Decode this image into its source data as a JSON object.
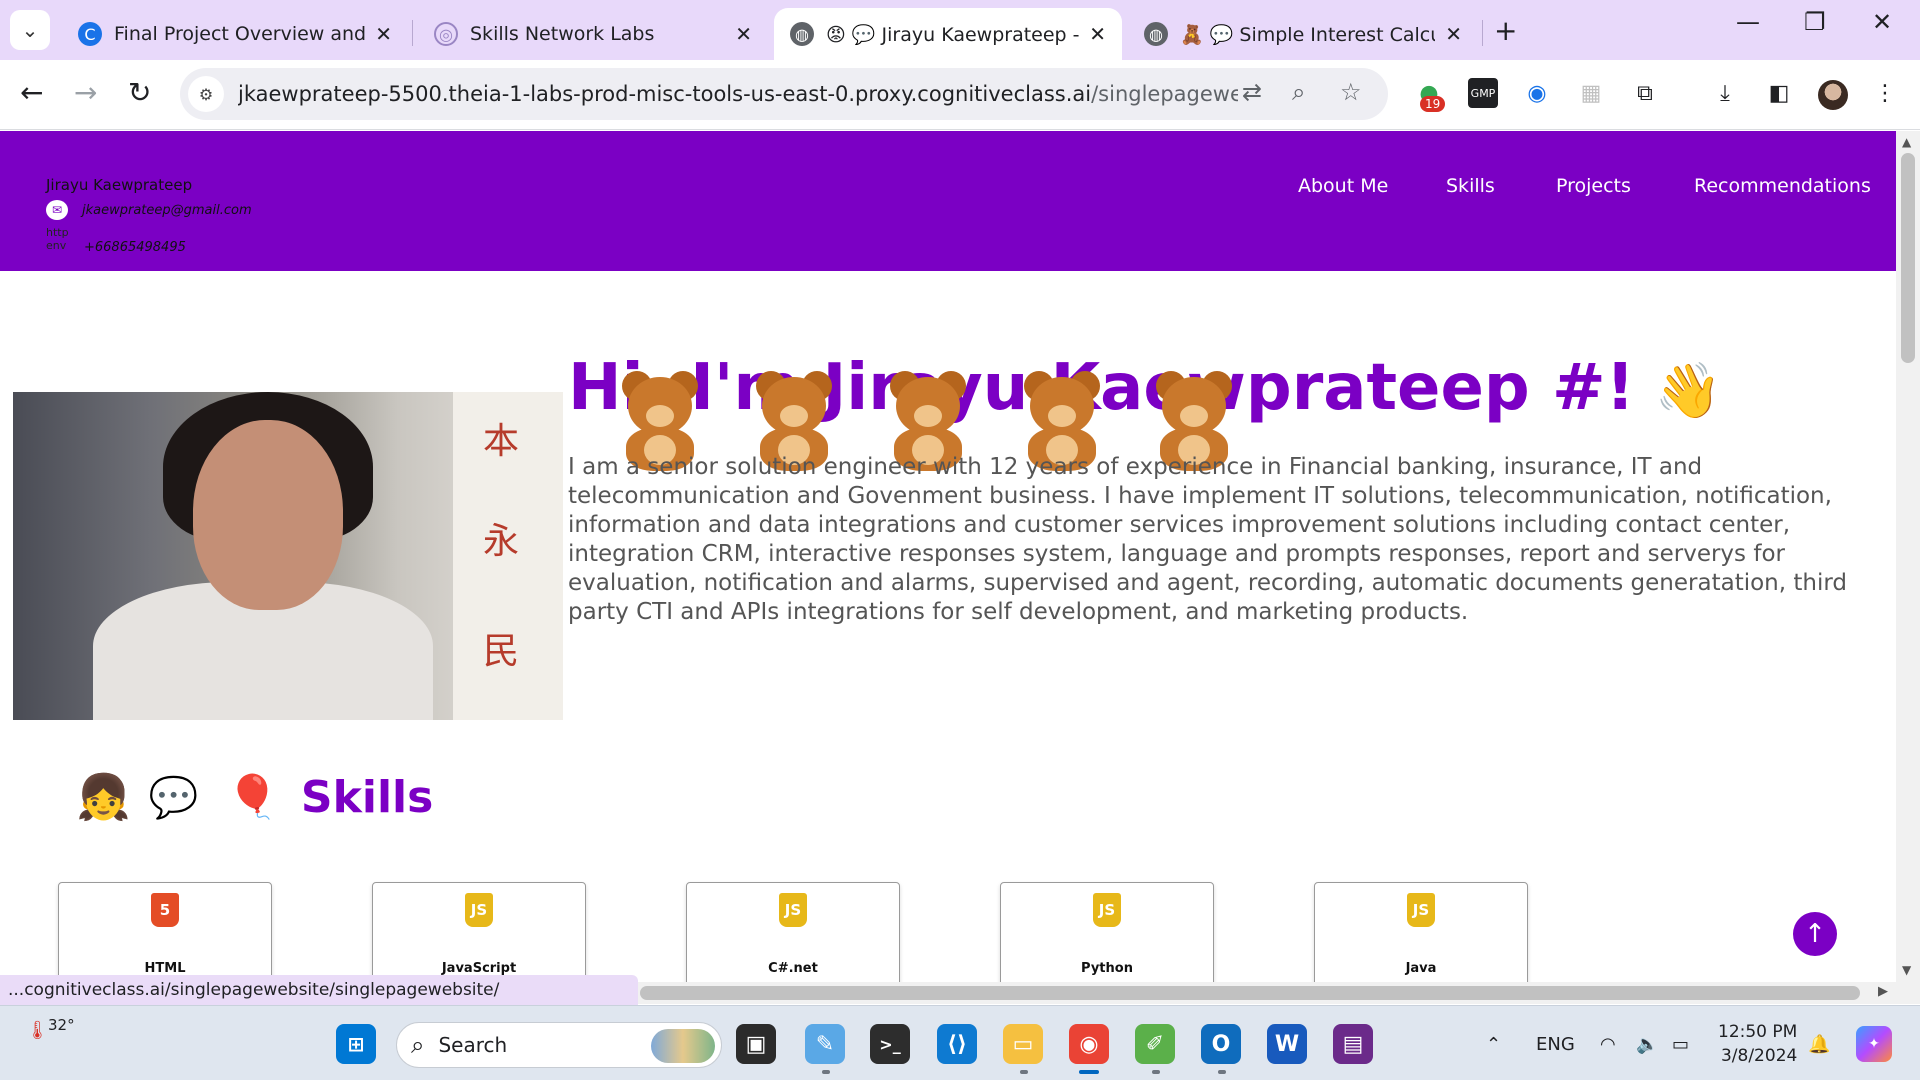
{
  "browser": {
    "tabs": [
      {
        "title": "Final Project Overview and Revi",
        "icon": "coursera-icon"
      },
      {
        "title": "Skills Network Labs",
        "icon": "skillsnetwork-icon"
      },
      {
        "title": "😡 💬 Jirayu Kaewprateep - Por",
        "icon": "globe-icon"
      },
      {
        "title": "🧸 💬 Simple Interest Calculato",
        "icon": "globe-icon"
      }
    ],
    "url_host": "jkaewprateep-5500.theia-1-labs-prod-misc-tools-us-east-0.proxy.cognitiveclass.ai",
    "url_path": "/singlepagewebsite/#ho...",
    "extension_badge": "19",
    "status_url": "...cognitiveclass.ai/singlepagewebsite/singlepagewebsite/"
  },
  "header": {
    "name": "Jirayu Kaewprateep",
    "email": "jkaewprateep@gmail.com",
    "phone": "+66865498495",
    "broken_image_alt": "http env",
    "nav": [
      "About Me",
      "Skills",
      "Projects",
      "Recommendations"
    ]
  },
  "hero": {
    "title": "Hi, I'm Jirayu Kaewprateep #!",
    "wave": "👋",
    "bio": "I am a senior solution engineer with 12 years of experience in Financial banking, insurance, IT and telecommunication and Govenment business. I have implement IT solutions, telecommunication, notification, information and data integrations and customer services improvement solutions including contact center, integration CRM, interactive responses system, language and prompts responses, report and serverys for evaluation, notification and alarms, supervised and agent, recording, automatic documents generatation, third party CTI and APIs integrations for self development, and marketing products."
  },
  "skills": {
    "title": "Skills",
    "emojis": [
      "👧",
      "💬",
      "🎈"
    ],
    "items": [
      {
        "name": "HTML",
        "logo": "5",
        "color": "#e44d26"
      },
      {
        "name": "JavaScript",
        "logo": "JS",
        "color": "#e7b819"
      },
      {
        "name": "C#.net",
        "logo": "JS",
        "color": "#e7b819"
      },
      {
        "name": "Python",
        "logo": "JS",
        "color": "#e7b819"
      },
      {
        "name": "Java",
        "logo": "JS",
        "color": "#e7b819"
      }
    ]
  },
  "taskbar": {
    "temperature": "32°",
    "search_label": "Search",
    "language": "ENG",
    "time": "12:50 PM",
    "date": "3/8/2024"
  },
  "colors": {
    "brand": "#7b00c4",
    "tabstrip": "#e8d9fa"
  }
}
